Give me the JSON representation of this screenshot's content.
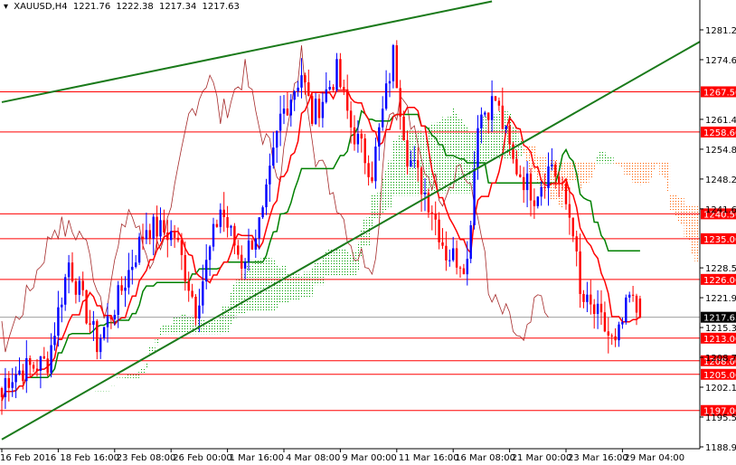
{
  "header": {
    "symbol": "XAUUSD,H4",
    "open": "1221.76",
    "high": "1222.38",
    "low": "1217.34",
    "close": "1217.63"
  },
  "chart_data": {
    "type": "candlestick",
    "title": "XAUUSD,H4",
    "ylim": [
      1186.0,
      1288.0
    ],
    "y_ticks": [
      "1281.20",
      "1274.60",
      "1261.40",
      "1254.80",
      "1248.20",
      "1241.60",
      "1228.55",
      "1221.95",
      "1215.35",
      "1208.75",
      "1202.15",
      "1195.55",
      "1188.95"
    ],
    "x_ticks": [
      {
        "label": "16 Feb 2016",
        "bar": 0
      },
      {
        "label": "18 Feb 16:00",
        "bar": 16
      },
      {
        "label": "23 Feb 08:00",
        "bar": 32
      },
      {
        "label": "26 Feb 00:00",
        "bar": 48
      },
      {
        "label": "1 Mar 16:00",
        "bar": 64
      },
      {
        "label": "4 Mar 08:00",
        "bar": 80
      },
      {
        "label": "9 Mar 00:00",
        "bar": 96
      },
      {
        "label": "11 Mar 16:00",
        "bar": 112
      },
      {
        "label": "16 Mar 08:00",
        "bar": 128
      },
      {
        "label": "21 Mar 00:00",
        "bar": 144
      },
      {
        "label": "23 Mar 16:00",
        "bar": 160
      },
      {
        "label": "29 Mar 04:00",
        "bar": 176
      }
    ],
    "price_path": [
      [
        0,
        1200
      ],
      [
        1,
        1203.8
      ],
      [
        5,
        1205.8
      ],
      [
        13,
        1207.8
      ],
      [
        19,
        1229.8
      ],
      [
        27,
        1211.8
      ],
      [
        33,
        1221.8
      ],
      [
        41,
        1237.8
      ],
      [
        49,
        1235.8
      ],
      [
        55,
        1219.8
      ],
      [
        62,
        1241.8
      ],
      [
        68,
        1229.8
      ],
      [
        74,
        1239.8
      ],
      [
        79,
        1261.8
      ],
      [
        85,
        1271.8
      ],
      [
        88,
        1261.8
      ],
      [
        95,
        1271.8
      ],
      [
        99,
        1259.8
      ],
      [
        105,
        1249.8
      ],
      [
        111,
        1275.8
      ],
      [
        115,
        1253.8
      ],
      [
        122,
        1241.8
      ],
      [
        126,
        1231.8
      ],
      [
        132,
        1229.8
      ],
      [
        135,
        1261.8
      ],
      [
        140,
        1265.8
      ],
      [
        145,
        1251.8
      ],
      [
        151,
        1244.8
      ],
      [
        156,
        1251.8
      ],
      [
        162,
        1237.8
      ],
      [
        164,
        1221.8
      ],
      [
        169,
        1217.8
      ],
      [
        174,
        1210.8
      ],
      [
        178,
        1221.8
      ],
      [
        181,
        1217.63
      ]
    ],
    "levels": [
      "1267.50",
      "1258.60",
      "1240.50",
      "1235.00",
      "1226.00",
      "1213.00",
      "1208.00",
      "1205.00",
      "1197.00"
    ],
    "current_price": "1217.63",
    "trendlines": [
      {
        "name": "upper-trendline",
        "from": [
          0,
          1265.2
        ],
        "to": [
          139,
          1287.5
        ]
      },
      {
        "name": "lower-trendline",
        "from": [
          0,
          1190.6
        ],
        "to": [
          198,
          1278.6
        ]
      }
    ],
    "indicators": [
      "Ichimoku tenkan (red)",
      "Ichimoku kijun (green)",
      "Chikou (brown)",
      "Kumo cloud"
    ],
    "colors": {
      "up": "#0000ff",
      "down": "#ff0000",
      "level": "#ff0000",
      "tenkan": "#ff0000",
      "kijun": "#008000",
      "chikou": "#a52a2a",
      "trend": "#1a7a1a",
      "cloud_bull": "#00a000",
      "cloud_bear": "#ff6000"
    }
  }
}
